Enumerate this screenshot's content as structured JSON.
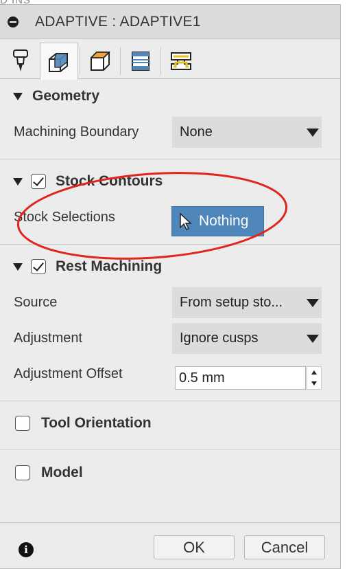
{
  "background": {
    "fragment": "D INS"
  },
  "window": {
    "title": "ADAPTIVE : ADAPTIVE1"
  },
  "tabs": [
    {
      "name": "tool-icon",
      "active": false
    },
    {
      "name": "geometry-icon",
      "active": true
    },
    {
      "name": "heights-icon",
      "active": false
    },
    {
      "name": "passes-icon",
      "active": false
    },
    {
      "name": "linking-icon",
      "active": false
    }
  ],
  "geometry": {
    "header": "Geometry",
    "machining_boundary_label": "Machining Boundary",
    "machining_boundary_value": "None"
  },
  "stock_contours": {
    "header": "Stock Contours",
    "checked": true,
    "selections_label": "Stock Selections",
    "selections_button": "Nothing"
  },
  "rest_machining": {
    "header": "Rest Machining",
    "checked": true,
    "source_label": "Source",
    "source_value": "From setup sto...",
    "adjustment_label": "Adjustment",
    "adjustment_value": "Ignore cusps",
    "offset_label": "Adjustment Offset",
    "offset_value": "0.5 mm"
  },
  "tool_orientation": {
    "header": "Tool Orientation",
    "checked": false
  },
  "model": {
    "header": "Model",
    "checked": false
  },
  "footer": {
    "info": "i",
    "ok_label": "OK",
    "cancel_label": "Cancel"
  },
  "colors": {
    "selection_blue": "#4f87bb",
    "annotation_red": "#e0261c",
    "panel_bg": "#ececec"
  }
}
